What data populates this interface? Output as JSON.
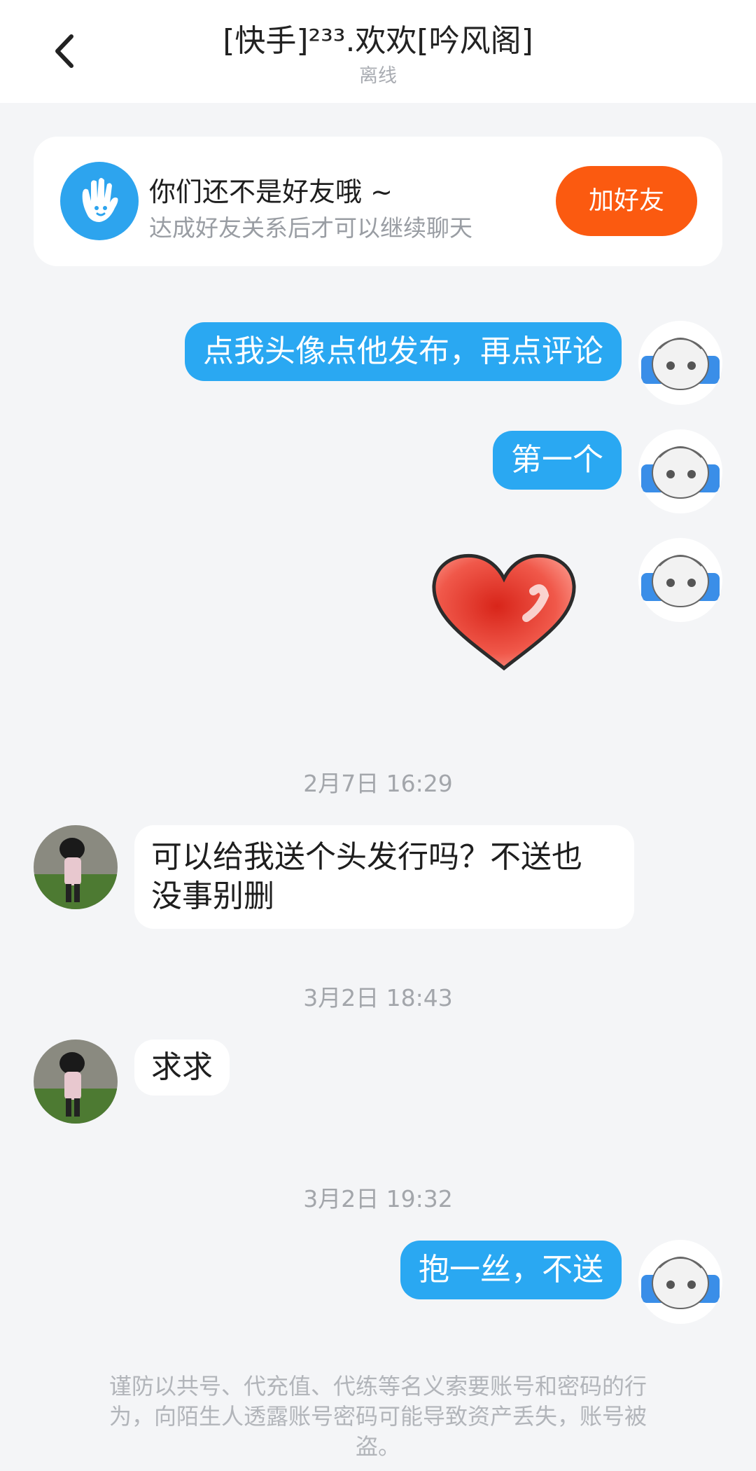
{
  "header": {
    "back_icon": "chevron-left-icon",
    "title": "[快手]²³³.欢欢[吟风阁]",
    "status": "离线"
  },
  "friend_card": {
    "icon": "hand-wave-icon",
    "title": "你们还不是好友哦 ~",
    "subtitle": "达成好友关系后才可以继续聊天",
    "add_button": "加好友"
  },
  "messages": [
    {
      "from": "me",
      "type": "text",
      "text": "点我头像点他发布，再点评论"
    },
    {
      "from": "me",
      "type": "text",
      "text": "第一个"
    },
    {
      "from": "me",
      "type": "emoji",
      "emoji": "heart-sticker"
    },
    {
      "type": "timestamp",
      "text": "2月7日 16:29"
    },
    {
      "from": "other",
      "type": "text",
      "text": "可以给我送个头发行吗？不送也没事别删",
      "line1": "可以给我送个头发行吗？不送也",
      "line2": "没事别删"
    },
    {
      "type": "timestamp",
      "text": "3月2日 18:43"
    },
    {
      "from": "other",
      "type": "text",
      "text": "求求"
    },
    {
      "type": "timestamp",
      "text": "3月2日 19:32"
    },
    {
      "from": "me",
      "type": "text",
      "text": "抱一丝，不送"
    }
  ],
  "footer_warning": {
    "line1": "谨防以共号、代充值、代练等名义索要账号和密码的行",
    "line2": "为，向陌生人透露账号密码可能导致资产丢失，账号被",
    "line3": "盗。"
  },
  "colors": {
    "accent_blue": "#2aa8f2",
    "add_button_orange": "#fb5a10",
    "background": "#f4f5f7"
  }
}
